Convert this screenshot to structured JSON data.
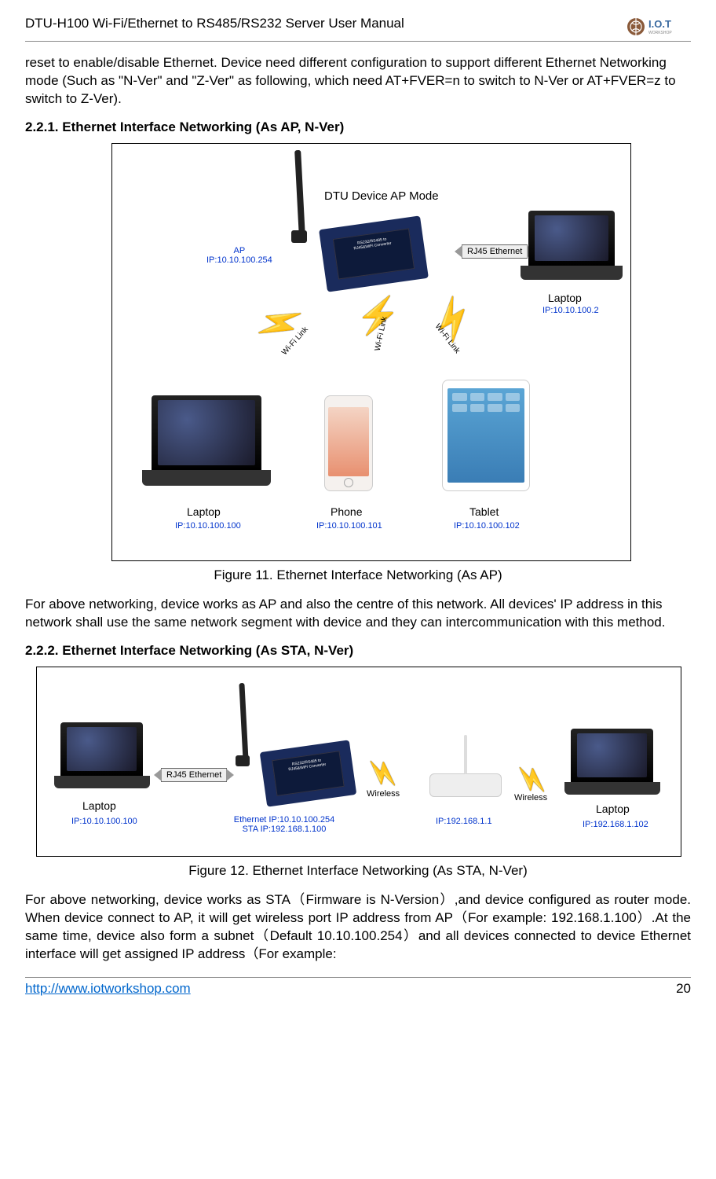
{
  "header": {
    "title": "DTU-H100  Wi-Fi/Ethernet to RS485/RS232  Server User Manual",
    "logo_text_main": "I.O.T",
    "logo_text_sub": "WORKSHOP"
  },
  "intro_para": "reset to enable/disable Ethernet.  Device need different configuration to support different Ethernet Networking mode (Such as \"N-Ver\" and \"Z-Ver\" as following, which need AT+FVER=n to switch to N-Ver or AT+FVER=z to switch to Z-Ver).",
  "section_221": {
    "heading": "2.2.1.    Ethernet Interface Networking (As AP, N-Ver)",
    "fig_caption": "Figure 11.    Ethernet Interface Networking (As AP)",
    "fig": {
      "title": "DTU Device AP Mode",
      "ap_label": "AP",
      "ap_ip": "IP:10.10.100.254",
      "rj45": "RJ45 Ethernet",
      "wifi_link": "Wi-Fi Link",
      "laptop_r": {
        "name": "Laptop",
        "ip": "IP:10.10.100.2"
      },
      "laptop_l": {
        "name": "Laptop",
        "ip": "IP:10.10.100.100"
      },
      "phone": {
        "name": "Phone",
        "ip": "IP:10.10.100.101"
      },
      "tablet": {
        "name": "Tablet",
        "ip": "IP:10.10.100.102"
      }
    },
    "after_para": "For above networking, device works as AP and also the centre of this network. All devices' IP address in this network shall use the same network segment with device and they can intercommunication with this method."
  },
  "section_222": {
    "heading": "2.2.2.    Ethernet Interface Networking (As STA, N-Ver)",
    "fig_caption": "Figure 12.    Ethernet Interface Networking (As STA, N-Ver)",
    "fig": {
      "rj45": "RJ45 Ethernet",
      "wireless": "Wireless",
      "laptop_l": {
        "name": "Laptop",
        "ip": "IP:10.10.100.100"
      },
      "dtu": {
        "eth": "Ethernet IP:10.10.100.254",
        "sta": "STA IP:192.168.1.100"
      },
      "router_ip": "IP:192.168.1.1",
      "laptop_r": {
        "name": "Laptop",
        "ip": "IP:192.168.1.102"
      }
    },
    "after_para": "For above networking, device works as STA（Firmware is N-Version）,and device configured as router mode. When device connect to AP, it will get wireless port IP address from AP（For example: 192.168.1.100）.At the same time, device also form a subnet（Default 10.10.100.254）and all devices connected to device Ethernet interface will get assigned IP address（For example:"
  },
  "footer": {
    "link": "http://www.iotworkshop.com",
    "page": "20"
  }
}
